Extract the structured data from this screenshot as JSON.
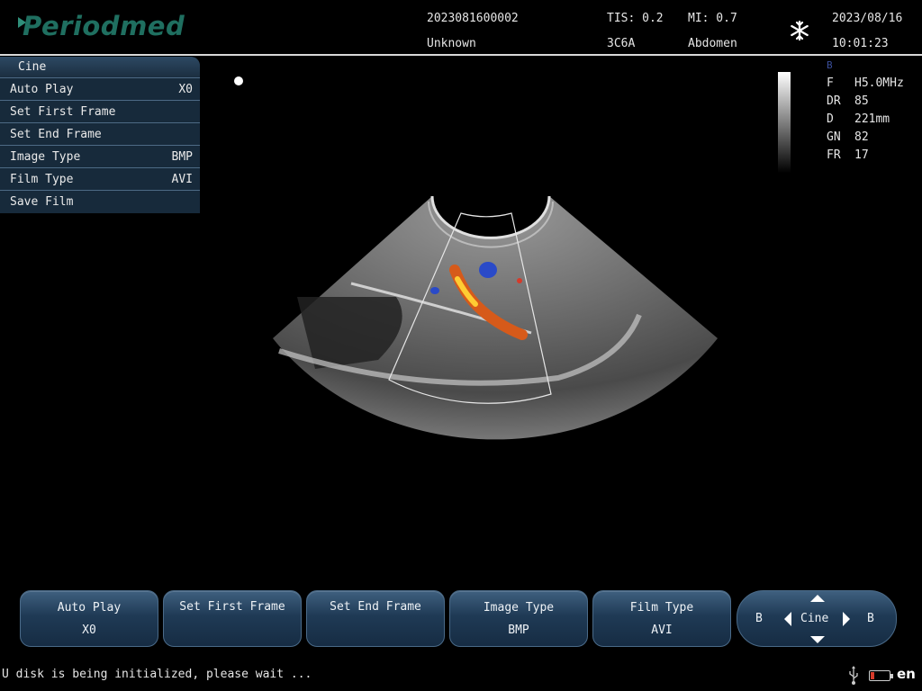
{
  "header": {
    "logo": "Periodmed",
    "patient_id": "2023081600002",
    "patient_name": "Unknown",
    "tis": "TIS: 0.2",
    "mi": "MI: 0.7",
    "probe": "3C6A",
    "exam": "Abdomen",
    "date": "2023/08/16",
    "time": "10:01:23",
    "freeze_icon": "snowflake-icon"
  },
  "menu": {
    "title": "Cine",
    "items": [
      {
        "label": "Auto Play",
        "value": "X0"
      },
      {
        "label": "Set First Frame",
        "value": ""
      },
      {
        "label": "Set End Frame",
        "value": ""
      },
      {
        "label": "Image Type",
        "value": "BMP"
      },
      {
        "label": "Film Type",
        "value": "AVI"
      },
      {
        "label": "Save Film",
        "value": ""
      }
    ]
  },
  "params": {
    "mode": "B",
    "rows": [
      {
        "key": "F",
        "value": "H5.0MHz"
      },
      {
        "key": "DR",
        "value": "85"
      },
      {
        "key": "D",
        "value": "221mm"
      },
      {
        "key": "GN",
        "value": "82"
      },
      {
        "key": "FR",
        "value": "17"
      }
    ]
  },
  "softkeys": [
    {
      "label": "Auto Play",
      "value": "X0"
    },
    {
      "label": "Set First Frame",
      "value": ""
    },
    {
      "label": "Set End Frame",
      "value": ""
    },
    {
      "label": "Image Type",
      "value": "BMP"
    },
    {
      "label": "Film Type",
      "value": "AVI"
    }
  ],
  "nav": {
    "left": "B",
    "center": "Cine",
    "right": "B"
  },
  "status": {
    "message": "U disk is being initialized, please wait ...",
    "usb_icon": "usb-icon",
    "battery_icon": "battery-icon",
    "language": "en"
  },
  "colors": {
    "menu_bg": "#172a3b",
    "softkey_accent": "#3f607f",
    "logo": "#1f6f60",
    "battery_low": "#d63a2a"
  }
}
